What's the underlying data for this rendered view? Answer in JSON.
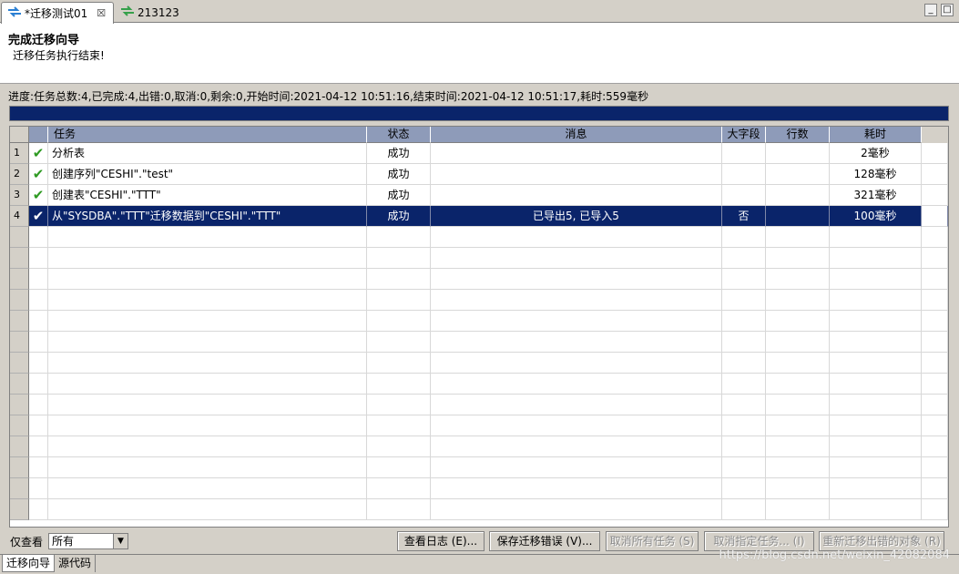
{
  "tabs": [
    {
      "label": "*迁移测试01",
      "close": "☒"
    },
    {
      "label": "213123"
    }
  ],
  "window_buttons": {
    "minimize": "_",
    "maximize": "□"
  },
  "header": {
    "title": "完成迁移向导",
    "description": "迁移任务执行结束!"
  },
  "progress": {
    "text": "进度:任务总数:4,已完成:4,出错:0,取消:0,剩余:0,开始时间:2021-04-12 10:51:16,结束时间:2021-04-12 10:51:17,耗时:559毫秒",
    "fraction": 1.0
  },
  "table": {
    "columns": [
      "任务",
      "状态",
      "消息",
      "大字段",
      "行数",
      "耗时"
    ],
    "rows": [
      {
        "num": "1",
        "task": "分析表",
        "status": "成功",
        "message": "",
        "lob": "",
        "rows": "",
        "time": "2毫秒"
      },
      {
        "num": "2",
        "task": "创建序列\"CESHI\".\"test\"",
        "status": "成功",
        "message": "",
        "lob": "",
        "rows": "",
        "time": "128毫秒"
      },
      {
        "num": "3",
        "task": "创建表\"CESHI\".\"TTT\"",
        "status": "成功",
        "message": "",
        "lob": "",
        "rows": "",
        "time": "321毫秒"
      },
      {
        "num": "4",
        "task": "从\"SYSDBA\".\"TTT\"迁移数据到\"CESHI\".\"TTT\"",
        "status": "成功",
        "message": "已导出5, 已导入5",
        "lob": "否",
        "rows": "",
        "time": "100毫秒"
      }
    ],
    "selected_row": 3,
    "status_icon": "check-icon"
  },
  "filter": {
    "label": "仅查看",
    "value": "所有"
  },
  "buttons": {
    "view_log": "查看日志 (E)...",
    "save_errors": "保存迁移错误 (V)...",
    "cancel_all": "取消所有任务 (S)",
    "cancel_selected": "取消指定任务... (I)",
    "retry_failed": "重新迁移出错的对象 (R)"
  },
  "bottom_tabs": [
    "迁移向导",
    "源代码"
  ],
  "watermark": "https://blog.csdn.net/weixin_42082084",
  "colors": {
    "selection": "#0a246a",
    "header": "#8e9bb9",
    "check": "#2e9a22",
    "progress": "#0a246a"
  }
}
